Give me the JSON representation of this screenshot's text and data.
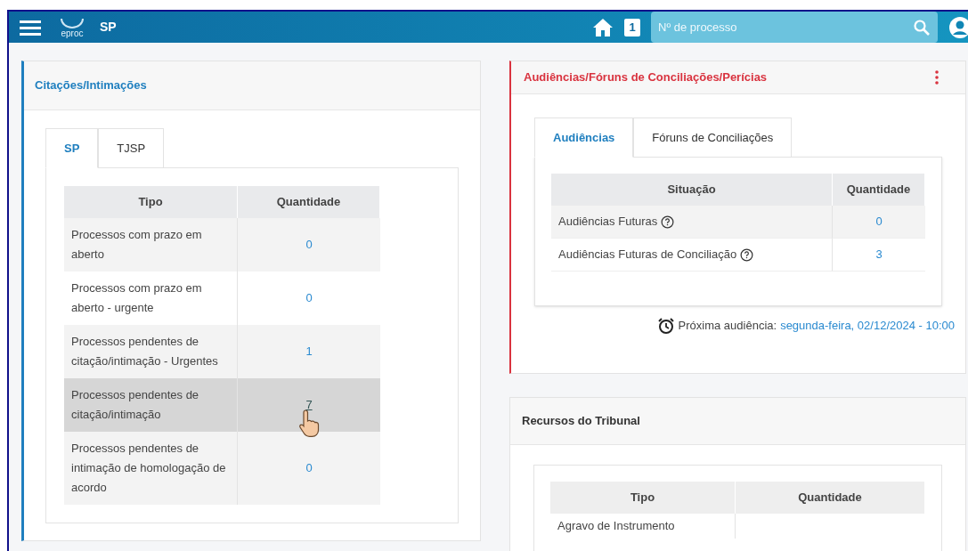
{
  "header": {
    "logo_text": "eproc",
    "title": "SP",
    "badge": "1",
    "search": {
      "placeholder": "Nº de processo"
    }
  },
  "citacoes": {
    "title": "Citações/Intimações",
    "tabs": [
      {
        "label": "SP",
        "selected": true
      },
      {
        "label": "TJSP",
        "selected": false
      }
    ],
    "columns": [
      "Tipo",
      "Quantidade"
    ],
    "rows": [
      {
        "tipo": "Processos com prazo em aberto",
        "quantidade": "0",
        "hovered": false
      },
      {
        "tipo": "Processos com prazo em aberto - urgente",
        "quantidade": "0",
        "hovered": false
      },
      {
        "tipo": "Processos pendentes de citação/intimação - Urgentes",
        "quantidade": "1",
        "hovered": false
      },
      {
        "tipo": "Processos pendentes de citação/intimação",
        "quantidade": "7",
        "hovered": true
      },
      {
        "tipo": "Processos pendentes de intimação de homologação de acordo",
        "quantidade": "0",
        "hovered": false
      }
    ]
  },
  "audiencias": {
    "title": "Audiências/Fóruns de Conciliações/Perícias",
    "tabs": [
      {
        "label": "Audiências",
        "selected": true
      },
      {
        "label": "Fóruns de Conciliações",
        "selected": false
      }
    ],
    "columns": [
      "Situação",
      "Quantidade"
    ],
    "rows": [
      {
        "situacao": "Audiências Futuras",
        "quantidade": "0"
      },
      {
        "situacao": "Audiências Futuras de Conciliação",
        "quantidade": "3"
      }
    ],
    "next_label": "Próxima audiência:",
    "next_value": "segunda-feira, 02/12/2024 - 10:00"
  },
  "recursos": {
    "title": "Recursos do Tribunal",
    "columns": [
      "Tipo",
      "Quantidade"
    ],
    "rows": [
      {
        "tipo": "Agravo de Instrumento"
      }
    ]
  }
}
